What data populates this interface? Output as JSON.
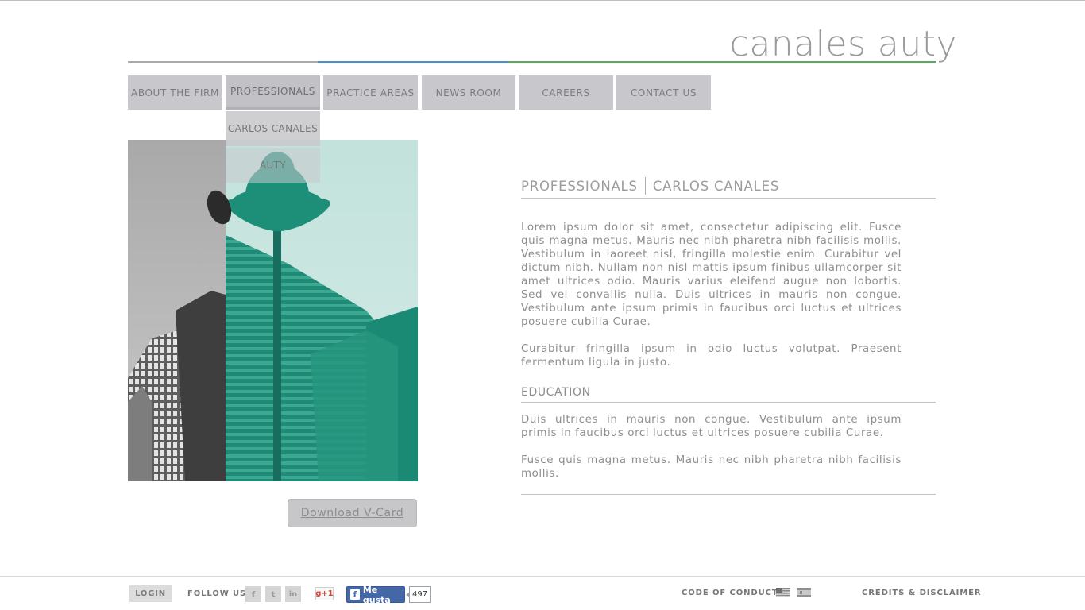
{
  "brand": {
    "logo_text": "canales auty"
  },
  "nav": {
    "items": [
      {
        "label": "ABOUT THE FIRM"
      },
      {
        "label": "PROFESSIONALS"
      },
      {
        "label": "PRACTICE AREAS"
      },
      {
        "label": "NEWS ROOM"
      },
      {
        "label": "CAREERS"
      },
      {
        "label": "CONTACT US"
      }
    ],
    "active": "PROFESSIONALS",
    "submenu": [
      {
        "label": "CARLOS CANALES"
      },
      {
        "label": "AUTY"
      }
    ]
  },
  "profile": {
    "vcard_label": "Download V-Card"
  },
  "content": {
    "breadcrumb": [
      "PROFESSIONALS",
      "CARLOS CANALES"
    ],
    "paragraphs": [
      "Lorem ipsum dolor sit amet, consectetur adipiscing elit. Fusce quis magna metus. Mauris nec nibh pharetra nibh facilisis mollis. Vestibulum in laoreet nisl, fringilla molestie enim. Curabitur vel dictum nibh. Nullam non nisl mattis ipsum finibus ullamcorper sit amet ultrices odio. Mauris varius eleifend augue non lobortis. Sed vel convallis nulla. Duis ultrices in mauris non congue. Vestibulum ante ipsum primis in faucibus orci luctus et ultrices posuere cubilia Curae.",
      "Curabitur fringilla ipsum in odio luctus volutpat. Praesent fermentum ligula in justo."
    ],
    "education_title": "EDUCATION",
    "education_paragraphs": [
      "Duis ultrices in mauris non congue. Vestibulum ante ipsum primis in faucibus orci luctus et ultrices posuere cubilia Curae.",
      "Fusce quis magna metus. Mauris nec nibh pharetra nibh facilisis mollis."
    ]
  },
  "footer": {
    "login_label": "LOGIN",
    "follow_label": "FOLLOW US",
    "social": [
      {
        "icon": "facebook-icon",
        "glyph": "f"
      },
      {
        "icon": "twitter-icon",
        "glyph": "t"
      },
      {
        "icon": "linkedin-icon",
        "glyph": "in"
      }
    ],
    "gplus_label": "g+1",
    "fb_like_label": "Me gusta",
    "fb_like_count": "497",
    "code_of_conduct": "CODE OF CONDUCT",
    "credits": "CREDITS & DISCLAIMER",
    "flags": [
      "us-flag-icon",
      "es-flag-icon"
    ]
  },
  "colors": {
    "accent_blue": "#4a8fd0",
    "accent_green": "#5aaa5a",
    "teal_overlay": "#2aa08a",
    "nav_bg": "#c8c8cc"
  }
}
